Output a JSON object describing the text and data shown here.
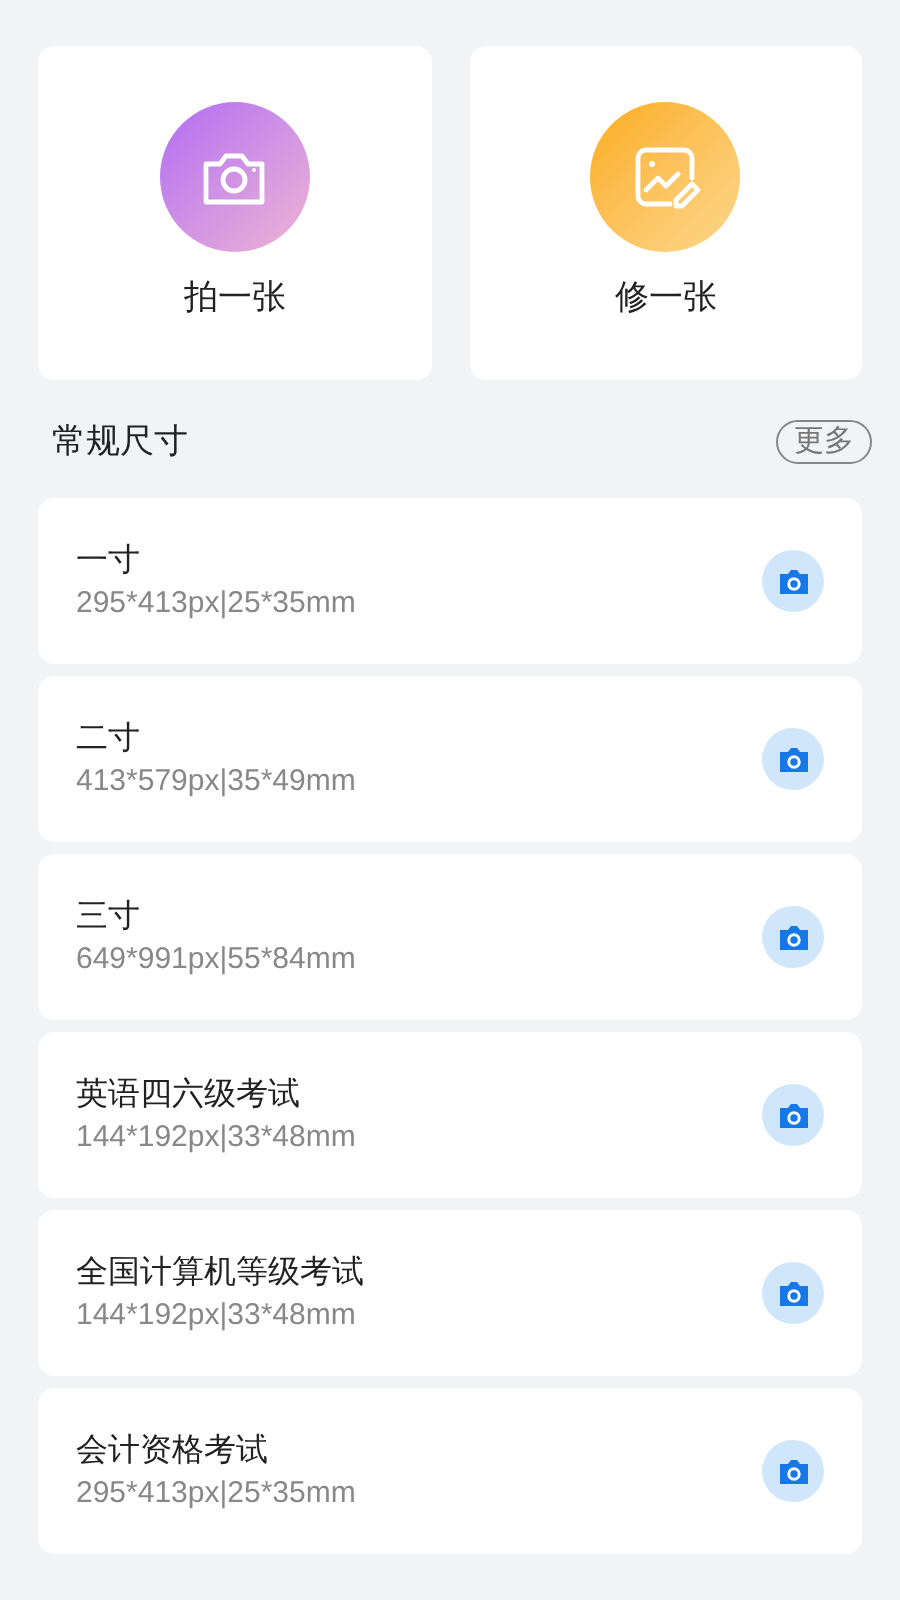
{
  "actions": [
    {
      "kind": "camera",
      "label": "拍一张"
    },
    {
      "kind": "edit",
      "label": "修一张"
    }
  ],
  "section": {
    "title": "常规尺寸",
    "more": "更多"
  },
  "sizes": [
    {
      "name": "一寸",
      "spec": "295*413px|25*35mm"
    },
    {
      "name": "二寸",
      "spec": "413*579px|35*49mm"
    },
    {
      "name": "三寸",
      "spec": "649*991px|55*84mm"
    },
    {
      "name": "英语四六级考试",
      "spec": "144*192px|33*48mm"
    },
    {
      "name": "全国计算机等级考试",
      "spec": "144*192px|33*48mm"
    },
    {
      "name": "会计资格考试",
      "spec": "295*413px|25*35mm"
    }
  ]
}
